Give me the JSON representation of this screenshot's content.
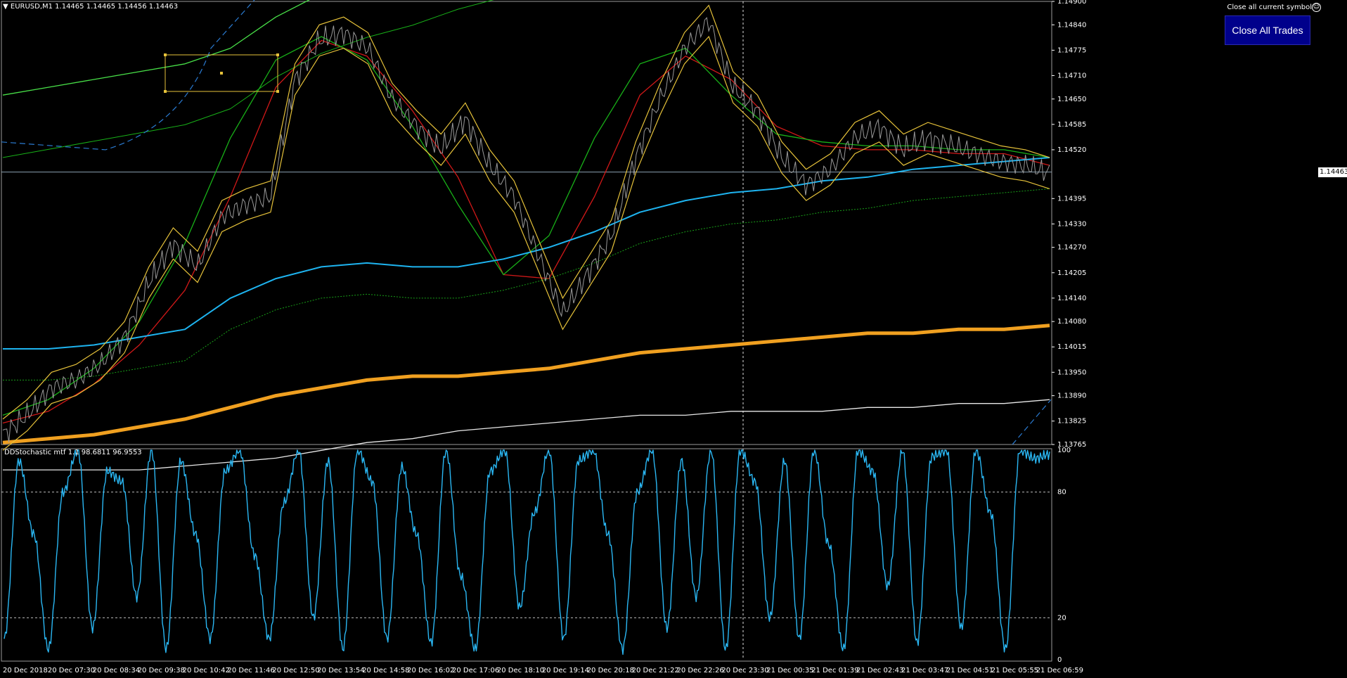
{
  "header": {
    "symbol_line": "▼ EURUSD,M1  1.14465 1.14465 1.14456 1.14463",
    "close_symbol_label": "Close all current symbol",
    "close_all_button": "Close All Trades",
    "smiley_icon": "smiley-icon"
  },
  "indicator": {
    "title": "DDStochastic mtf 1.1 98.6811 96.9553"
  },
  "current_price": "1.14463",
  "colors": {
    "background": "#000000",
    "price_axis_text": "#ffffff",
    "button_bg": "#00008b",
    "stoch_line": "#2ab7f3",
    "ma_red": "#d01818",
    "ma_green": "#18b018",
    "band_yellow": "#e6c23a",
    "ma_orange": "#f0a020",
    "ma_blue": "#1eb4f0",
    "ma_white": "#e8e8e8",
    "bright_green": "#48e048"
  },
  "chart_data": [
    {
      "type": "line",
      "title": "EURUSD,M1",
      "y_ticks": [
        "1.14900",
        "1.14840",
        "1.14775",
        "1.14710",
        "1.14650",
        "1.14585",
        "1.14520",
        "1.14463",
        "1.14395",
        "1.14330",
        "1.14270",
        "1.14205",
        "1.14140",
        "1.14080",
        "1.14015",
        "1.13950",
        "1.13890",
        "1.13825",
        "1.13765"
      ],
      "ylim": [
        1.13765,
        1.149
      ],
      "ohlc_last": {
        "open": 1.14465,
        "high": 1.14465,
        "low": 1.14456,
        "close": 1.14463
      },
      "x_labels": [
        "20 Dec 2018",
        "20 Dec 07:30",
        "20 Dec 08:34",
        "20 Dec 09:38",
        "20 Dec 10:42",
        "20 Dec 11:46",
        "20 Dec 12:50",
        "20 Dec 13:54",
        "20 Dec 14:58",
        "20 Dec 16:02",
        "20 Dec 17:06",
        "20 Dec 18:10",
        "20 Dec 19:14",
        "20 Dec 20:18",
        "20 Dec 21:22",
        "20 Dec 22:26",
        "20 Dec 23:30",
        "21 Dec 00:35",
        "21 Dec 01:39",
        "21 Dec 02:43",
        "21 Dec 03:47",
        "21 Dec 04:51",
        "21 Dec 05:55",
        "21 Dec 06:59"
      ],
      "price": [
        1.1379,
        1.1384,
        1.1391,
        1.1393,
        1.1397,
        1.1404,
        1.1418,
        1.1428,
        1.1422,
        1.1435,
        1.1438,
        1.144,
        1.147,
        1.148,
        1.1482,
        1.1478,
        1.1465,
        1.1458,
        1.1452,
        1.146,
        1.1448,
        1.144,
        1.1425,
        1.141,
        1.142,
        1.143,
        1.145,
        1.1465,
        1.1478,
        1.1485,
        1.1468,
        1.1462,
        1.145,
        1.1443,
        1.1447,
        1.1455,
        1.1458,
        1.1452,
        1.1455,
        1.1453,
        1.1451,
        1.1449,
        1.1448,
        1.1446
      ],
      "series": [
        {
          "name": "EMA 50",
          "color": "#d01818",
          "values": [
            1.1382,
            1.1385,
            1.1392,
            1.1402,
            1.1416,
            1.144,
            1.1468,
            1.148,
            1.1476,
            1.1462,
            1.1445,
            1.142,
            1.1419,
            1.144,
            1.1466,
            1.1476,
            1.147,
            1.1458,
            1.1453,
            1.1452,
            1.1452,
            1.1451,
            1.1451,
            1.1448
          ]
        },
        {
          "name": "EMA 34",
          "color": "#18b018",
          "values": [
            1.1384,
            1.1388,
            1.1396,
            1.1408,
            1.1428,
            1.1455,
            1.1475,
            1.1481,
            1.1475,
            1.1458,
            1.1438,
            1.142,
            1.143,
            1.1455,
            1.1474,
            1.1478,
            1.1466,
            1.1456,
            1.1454,
            1.1453,
            1.1453,
            1.1452,
            1.1452,
            1.145
          ]
        },
        {
          "name": "MA 200",
          "color": "#1eb4f0",
          "values": [
            1.1401,
            1.1401,
            1.1402,
            1.1404,
            1.1406,
            1.1414,
            1.1419,
            1.1422,
            1.1423,
            1.1422,
            1.1422,
            1.1424,
            1.1427,
            1.1431,
            1.1436,
            1.1439,
            1.1441,
            1.1442,
            1.1444,
            1.1445,
            1.1447,
            1.1448,
            1.1449,
            1.145
          ]
        },
        {
          "name": "MA 500",
          "color": "#f0a020",
          "values": [
            1.1377,
            1.1378,
            1.1379,
            1.1381,
            1.1383,
            1.1386,
            1.1389,
            1.1391,
            1.1393,
            1.1394,
            1.1394,
            1.1395,
            1.1396,
            1.1398,
            1.14,
            1.1401,
            1.1402,
            1.1403,
            1.1404,
            1.1405,
            1.1405,
            1.1406,
            1.1406,
            1.1407
          ]
        },
        {
          "name": "MA 1000",
          "color": "#e8e8e8",
          "values": [
            1.137,
            1.137,
            1.137,
            1.137,
            1.1371,
            1.1372,
            1.1373,
            1.1375,
            1.1377,
            1.1378,
            1.138,
            1.1381,
            1.1382,
            1.1383,
            1.1384,
            1.1384,
            1.1385,
            1.1385,
            1.1385,
            1.1386,
            1.1386,
            1.1387,
            1.1387,
            1.1388
          ]
        },
        {
          "name": "Channel Upper",
          "color": "#48e048",
          "values": [
            1.1466,
            1.1468,
            1.147,
            1.1472,
            1.1474,
            1.1478,
            1.1486,
            1.1492,
            1.1496,
            1.1499,
            1.1503,
            1.1506,
            1.1508,
            1.151,
            1.1512,
            1.1514,
            1.1516,
            1.1518,
            1.152,
            1.1522,
            1.1524,
            1.1526,
            1.1528,
            1.153
          ]
        }
      ]
    },
    {
      "type": "line",
      "title": "DDStochastic mtf 1.1 98.6811 96.9553",
      "ylim": [
        0,
        100
      ],
      "y_ticks": [
        "100",
        "80",
        "20",
        "0"
      ],
      "levels": [
        80,
        20
      ],
      "series": [
        {
          "name": "",
          "color": "#2ab7f3",
          "values": [
            10,
            95,
            60,
            5,
            80,
            100,
            15,
            90,
            85,
            30,
            100,
            5,
            95,
            60,
            10,
            90,
            100,
            50,
            10,
            75,
            100,
            20,
            95,
            5,
            100,
            85,
            10,
            92,
            60,
            8,
            100,
            40,
            5,
            90,
            100,
            25,
            70,
            100,
            10,
            95,
            100,
            60,
            5,
            80,
            100,
            15,
            95,
            30,
            100,
            5,
            100,
            85,
            20,
            95,
            10,
            100,
            55,
            5,
            100,
            90,
            35,
            100,
            8,
            97,
            100,
            15,
            100,
            70,
            5,
            100,
            96,
            98
          ]
        }
      ]
    }
  ]
}
